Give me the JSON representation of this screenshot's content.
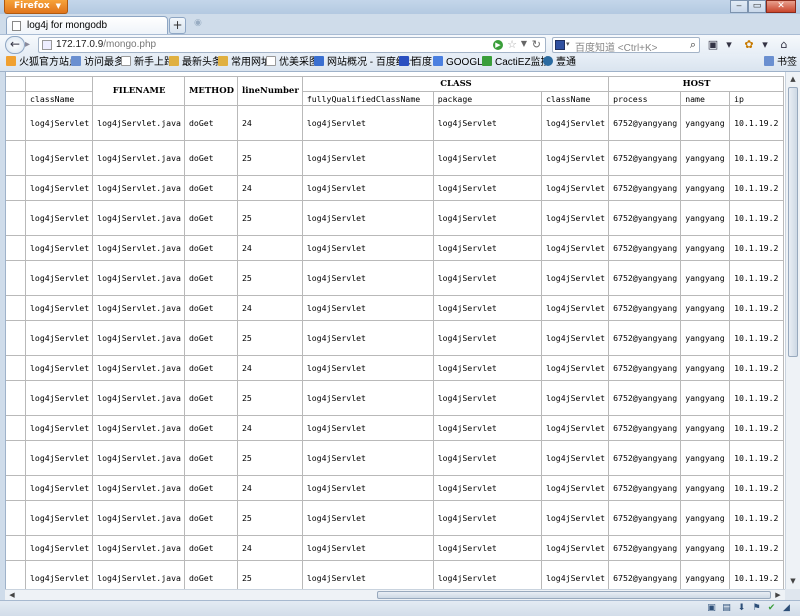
{
  "browser": {
    "app_button": "Firefox",
    "tab_title": "log4j for mongodb",
    "ghost_tab_text": "",
    "url_host": "172.17.0.9",
    "url_path": "/mongo.php",
    "search_placeholder": "百度知道 <Ctrl+K>",
    "bookmarks": [
      "火狐官方站点",
      "访问最多",
      "新手上路",
      "最新头条",
      "常用网址",
      "优美采图",
      "网站概况 - 百度统计",
      "百度",
      "GOOGLE",
      "CactiEZ监控",
      "壹通"
    ],
    "bookmarks_menu": "书签",
    "colors": {
      "chrome": "#cfdcea",
      "firefox_orange": "#e8862b"
    }
  },
  "table": {
    "group_headers": {
      "class": "CLASS",
      "host": "HOST"
    },
    "headers": {
      "classname": "className",
      "filename": "FILENAME",
      "method": "METHOD",
      "line": "lineNumber",
      "fqcn": "fullyQualifiedClassName",
      "package": "package",
      "class_classname": "className",
      "process": "process",
      "name": "name",
      "ip": "ip"
    },
    "rows": [
      {
        "classname": "log4jServlet",
        "filename": "log4jServlet.java",
        "method": "doGet",
        "line": "24",
        "fqcn": "log4jServlet",
        "package": "log4jServlet",
        "cls": "log4jServlet",
        "process": "6752@yangyang",
        "name": "yangyang",
        "ip": "10.1.19.2"
      },
      {
        "classname": "log4jServlet",
        "filename": "log4jServlet.java",
        "method": "doGet",
        "line": "25",
        "fqcn": "log4jServlet",
        "package": "log4jServlet",
        "cls": "log4jServlet",
        "process": "6752@yangyang",
        "name": "yangyang",
        "ip": "10.1.19.2"
      },
      {
        "classname": "log4jServlet",
        "filename": "log4jServlet.java",
        "method": "doGet",
        "line": "24",
        "fqcn": "log4jServlet",
        "package": "log4jServlet",
        "cls": "log4jServlet",
        "process": "6752@yangyang",
        "name": "yangyang",
        "ip": "10.1.19.2"
      },
      {
        "classname": "log4jServlet",
        "filename": "log4jServlet.java",
        "method": "doGet",
        "line": "25",
        "fqcn": "log4jServlet",
        "package": "log4jServlet",
        "cls": "log4jServlet",
        "process": "6752@yangyang",
        "name": "yangyang",
        "ip": "10.1.19.2"
      },
      {
        "classname": "log4jServlet",
        "filename": "log4jServlet.java",
        "method": "doGet",
        "line": "24",
        "fqcn": "log4jServlet",
        "package": "log4jServlet",
        "cls": "log4jServlet",
        "process": "6752@yangyang",
        "name": "yangyang",
        "ip": "10.1.19.2"
      },
      {
        "classname": "log4jServlet",
        "filename": "log4jServlet.java",
        "method": "doGet",
        "line": "25",
        "fqcn": "log4jServlet",
        "package": "log4jServlet",
        "cls": "log4jServlet",
        "process": "6752@yangyang",
        "name": "yangyang",
        "ip": "10.1.19.2"
      },
      {
        "classname": "log4jServlet",
        "filename": "log4jServlet.java",
        "method": "doGet",
        "line": "24",
        "fqcn": "log4jServlet",
        "package": "log4jServlet",
        "cls": "log4jServlet",
        "process": "6752@yangyang",
        "name": "yangyang",
        "ip": "10.1.19.2"
      },
      {
        "classname": "log4jServlet",
        "filename": "log4jServlet.java",
        "method": "doGet",
        "line": "25",
        "fqcn": "log4jServlet",
        "package": "log4jServlet",
        "cls": "log4jServlet",
        "process": "6752@yangyang",
        "name": "yangyang",
        "ip": "10.1.19.2"
      },
      {
        "classname": "log4jServlet",
        "filename": "log4jServlet.java",
        "method": "doGet",
        "line": "24",
        "fqcn": "log4jServlet",
        "package": "log4jServlet",
        "cls": "log4jServlet",
        "process": "6752@yangyang",
        "name": "yangyang",
        "ip": "10.1.19.2"
      },
      {
        "classname": "log4jServlet",
        "filename": "log4jServlet.java",
        "method": "doGet",
        "line": "25",
        "fqcn": "log4jServlet",
        "package": "log4jServlet",
        "cls": "log4jServlet",
        "process": "6752@yangyang",
        "name": "yangyang",
        "ip": "10.1.19.2"
      },
      {
        "classname": "log4jServlet",
        "filename": "log4jServlet.java",
        "method": "doGet",
        "line": "24",
        "fqcn": "log4jServlet",
        "package": "log4jServlet",
        "cls": "log4jServlet",
        "process": "6752@yangyang",
        "name": "yangyang",
        "ip": "10.1.19.2"
      },
      {
        "classname": "log4jServlet",
        "filename": "log4jServlet.java",
        "method": "doGet",
        "line": "25",
        "fqcn": "log4jServlet",
        "package": "log4jServlet",
        "cls": "log4jServlet",
        "process": "6752@yangyang",
        "name": "yangyang",
        "ip": "10.1.19.2"
      },
      {
        "classname": "log4jServlet",
        "filename": "log4jServlet.java",
        "method": "doGet",
        "line": "24",
        "fqcn": "log4jServlet",
        "package": "log4jServlet",
        "cls": "log4jServlet",
        "process": "6752@yangyang",
        "name": "yangyang",
        "ip": "10.1.19.2"
      },
      {
        "classname": "log4jServlet",
        "filename": "log4jServlet.java",
        "method": "doGet",
        "line": "25",
        "fqcn": "log4jServlet",
        "package": "log4jServlet",
        "cls": "log4jServlet",
        "process": "6752@yangyang",
        "name": "yangyang",
        "ip": "10.1.19.2"
      },
      {
        "classname": "log4jServlet",
        "filename": "log4jServlet.java",
        "method": "doGet",
        "line": "24",
        "fqcn": "log4jServlet",
        "package": "log4jServlet",
        "cls": "log4jServlet",
        "process": "6752@yangyang",
        "name": "yangyang",
        "ip": "10.1.19.2"
      },
      {
        "classname": "log4jServlet",
        "filename": "log4jServlet.java",
        "method": "doGet",
        "line": "25",
        "fqcn": "log4jServlet",
        "package": "log4jServlet",
        "cls": "log4jServlet",
        "process": "6752@yangyang",
        "name": "yangyang",
        "ip": "10.1.19.2"
      }
    ]
  }
}
